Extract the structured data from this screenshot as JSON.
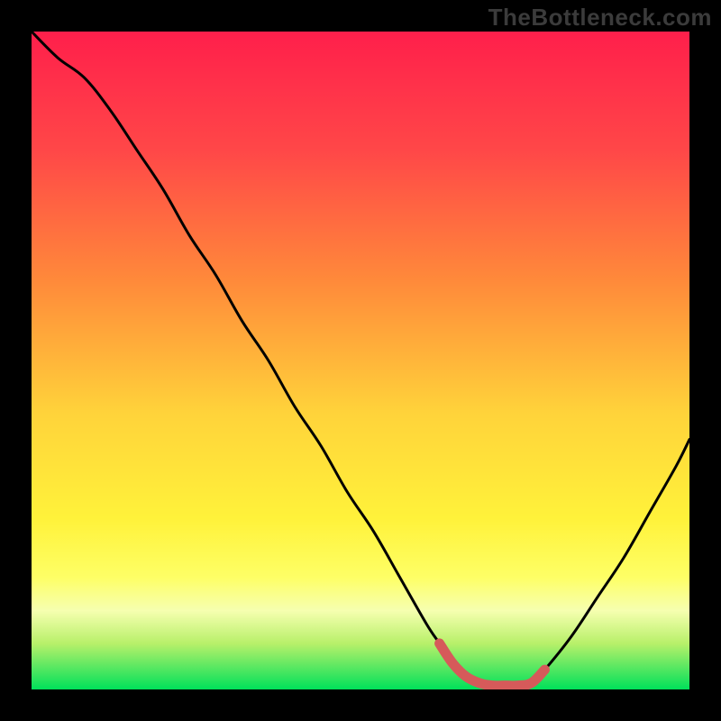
{
  "watermark": "TheBottleneck.com",
  "colors": {
    "frame": "#000000",
    "watermark_text": "#3b3b3b",
    "curve_stroke": "#000000",
    "highlight_stroke": "#d65a5a",
    "gradient_stops": [
      {
        "offset": 0.0,
        "color": "#ff1f4b"
      },
      {
        "offset": 0.18,
        "color": "#ff4748"
      },
      {
        "offset": 0.38,
        "color": "#ff8a3a"
      },
      {
        "offset": 0.58,
        "color": "#ffd33a"
      },
      {
        "offset": 0.74,
        "color": "#fff23a"
      },
      {
        "offset": 0.83,
        "color": "#feff66"
      },
      {
        "offset": 0.88,
        "color": "#f6ffb0"
      },
      {
        "offset": 0.93,
        "color": "#b8f06a"
      },
      {
        "offset": 1.0,
        "color": "#00e05a"
      }
    ]
  },
  "chart_data": {
    "type": "line",
    "title": "",
    "xlabel": "",
    "ylabel": "",
    "xlim": [
      0,
      100
    ],
    "ylim": [
      0,
      100
    ],
    "series": [
      {
        "name": "bottleneck-curve",
        "x": [
          0,
          4,
          8,
          12,
          16,
          20,
          24,
          28,
          32,
          36,
          40,
          44,
          48,
          52,
          56,
          60,
          62,
          64,
          66,
          68,
          70,
          72,
          74,
          76,
          78,
          82,
          86,
          90,
          94,
          98,
          100
        ],
        "y": [
          100,
          96,
          93,
          88,
          82,
          76,
          69,
          63,
          56,
          50,
          43,
          37,
          30,
          24,
          17,
          10,
          7,
          4,
          2,
          1,
          0.6,
          0.6,
          0.6,
          1,
          3,
          8,
          14,
          20,
          27,
          34,
          38
        ]
      }
    ],
    "highlight_segment": {
      "series": "bottleneck-curve",
      "x_start": 62,
      "x_end": 78
    },
    "gradient_background": {
      "top_color": "#ff1f4b",
      "bottom_color": "#00e05a"
    }
  }
}
